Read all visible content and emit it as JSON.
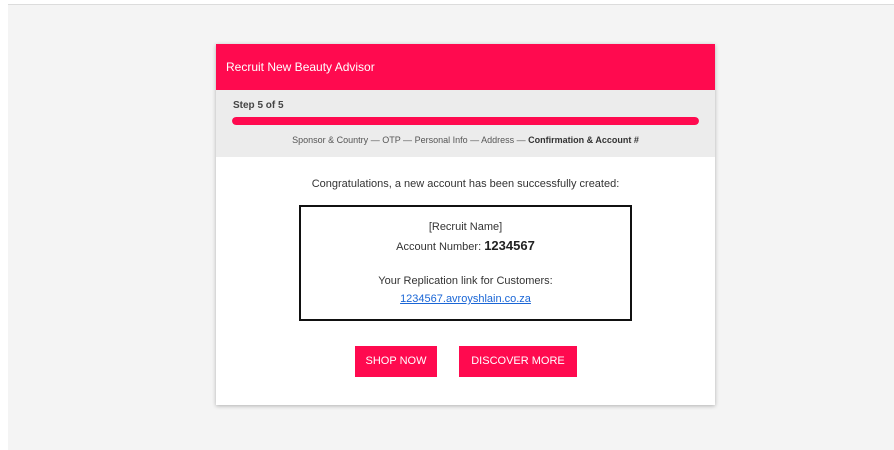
{
  "header": {
    "title": "Recruit New Beauty Advisor"
  },
  "progress": {
    "step_label": "Step 5 of 5",
    "fraction": 1.0,
    "steps": [
      "Sponsor & Country",
      "OTP",
      "Personal Info",
      "Address"
    ],
    "current_step": "Confirmation & Account #",
    "separator": " — "
  },
  "confirmation": {
    "message": "Congratulations, a new account has been successfully created:",
    "recruit_name": "[Recruit Name]",
    "account_number_label": "Account Number:",
    "account_number": "1234567",
    "replication_label": "Your Replication link for Customers:",
    "replication_link": "1234567.avroyshlain.co.za"
  },
  "actions": {
    "shop_now": "SHOP NOW",
    "discover_more": "DISCOVER MORE"
  },
  "colors": {
    "brand": "#ff0a4f",
    "link": "#1a66d6"
  }
}
